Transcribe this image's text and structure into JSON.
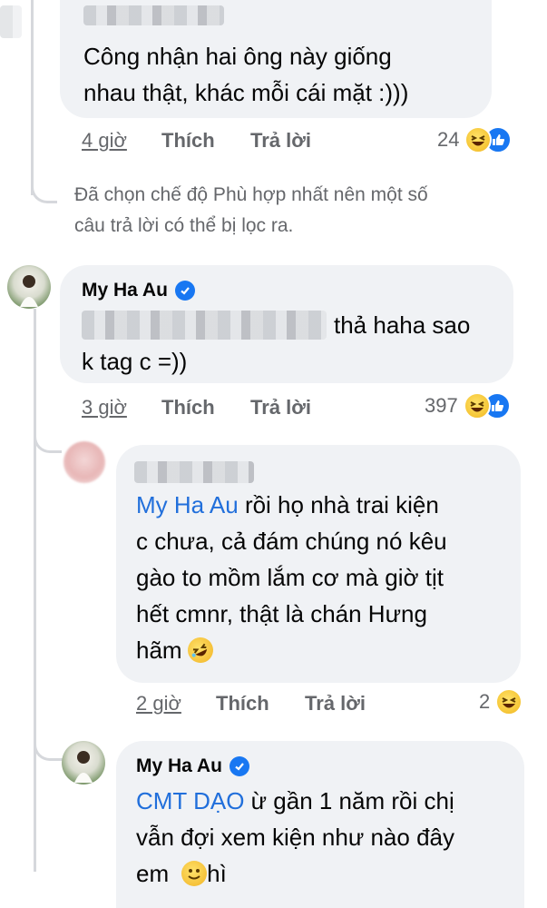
{
  "comment1": {
    "text_line1": "Công nhận hai ông này giống",
    "text_line2": "nhau thật, khác mỗi cái mặt :)))",
    "time": "4 giờ",
    "like_label": "Thích",
    "reply_label": "Trả lời",
    "reaction_count": "24",
    "reaction_icons": [
      "haha-emoji-icon",
      "like-icon"
    ]
  },
  "filter_notice": {
    "line1": "Đã chọn chế độ Phù hợp nhất nên một số",
    "line2": "câu trả lời có thể bị lọc ra."
  },
  "comment2": {
    "author": "My Ha Au",
    "text_line1": "thả haha sao",
    "text_line2": "k tag c =))",
    "time": "3 giờ",
    "like_label": "Thích",
    "reply_label": "Trả lời",
    "reaction_count": "397",
    "reaction_icons": [
      "haha-emoji-icon",
      "like-icon"
    ]
  },
  "reply1": {
    "mention": "My Ha Au",
    "text_line1": " rồi họ nhà trai kiện",
    "text_line2": "c chưa, cả đám chúng nó kêu",
    "text_line3": "gào to mồm lắm cơ mà giờ tịt",
    "text_line4": "hết cmnr, thật là chán Hưng",
    "text_line5": "hãm",
    "time": "2 giờ",
    "like_label": "Thích",
    "reply_label": "Trả lời",
    "reaction_count": "2",
    "reaction_icons": [
      "haha-emoji-icon"
    ]
  },
  "reply2": {
    "author": "My Ha Au",
    "mention": "CMT DẠO",
    "text_line1": " ừ gần 1 năm rồi chị",
    "text_line2": "vẫn đợi xem kiện như nào đây",
    "text_line3": "em",
    "text_line3b": " hì"
  },
  "colors": {
    "bubble": "#f0f2f5",
    "mention": "#216fdb",
    "meta": "#65676b",
    "verified": "#1877f2"
  }
}
